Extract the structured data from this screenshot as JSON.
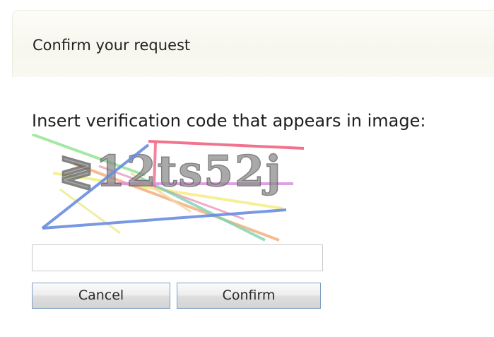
{
  "dialog": {
    "title": "Confirm your request"
  },
  "verification": {
    "instruction": "Insert verification code that appears in image:",
    "captcha_text": "≷12ts52j",
    "input_value": "",
    "input_placeholder": ""
  },
  "buttons": {
    "cancel_label": "Cancel",
    "confirm_label": "Confirm"
  },
  "colors": {
    "button_border": "#7d9fc2",
    "header_background": "#f8f7ee"
  }
}
